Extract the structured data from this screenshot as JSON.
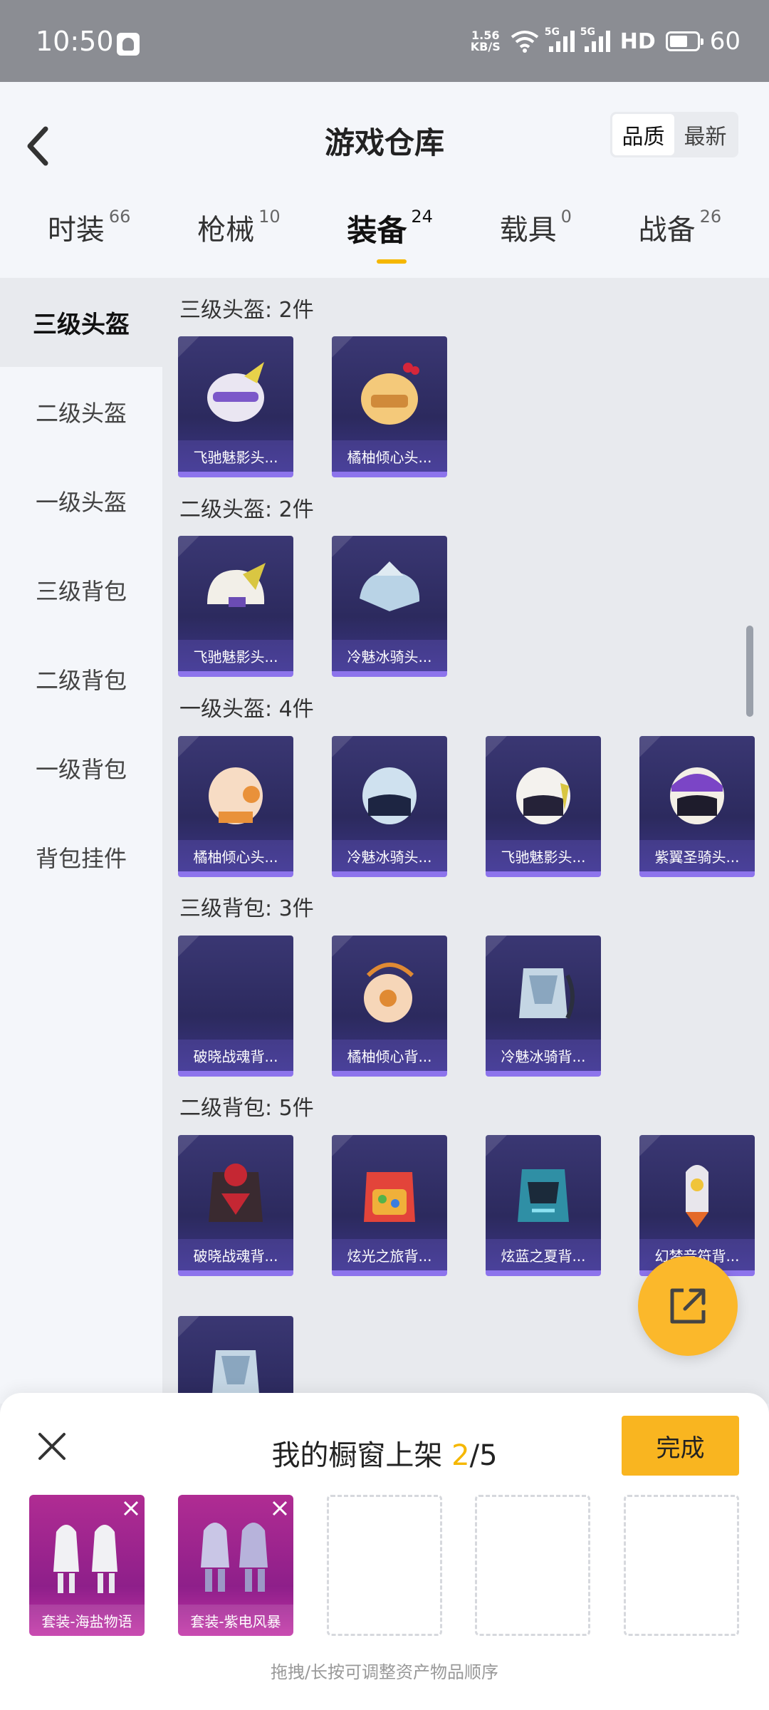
{
  "status": {
    "time": "10:50",
    "net_speed_top": "1.56",
    "net_speed_bottom": "KB/S",
    "battery": "60",
    "sim1": "5G",
    "sim2": "5G",
    "hd": "HD"
  },
  "header": {
    "title": "游戏仓库",
    "sort_quality": "品质",
    "sort_latest": "最新"
  },
  "tabs": [
    {
      "label": "时装",
      "count": "66"
    },
    {
      "label": "枪械",
      "count": "10"
    },
    {
      "label": "装备",
      "count": "24"
    },
    {
      "label": "载具",
      "count": "0"
    },
    {
      "label": "战备",
      "count": "26"
    }
  ],
  "sidebar": {
    "items": [
      "三级头盔",
      "二级头盔",
      "一级头盔",
      "三级背包",
      "二级背包",
      "一级背包",
      "背包挂件"
    ]
  },
  "sections": [
    {
      "title": "三级头盔: 2件",
      "items": [
        "飞驰魅影头...",
        "橘柚倾心头..."
      ]
    },
    {
      "title": "二级头盔: 2件",
      "items": [
        "飞驰魅影头...",
        "冷魅冰骑头..."
      ]
    },
    {
      "title": "一级头盔: 4件",
      "items": [
        "橘柚倾心头...",
        "冷魅冰骑头...",
        "飞驰魅影头...",
        "紫翼圣骑头..."
      ]
    },
    {
      "title": "三级背包: 3件",
      "items": [
        "破晓战魂背...",
        "橘柚倾心背...",
        "冷魅冰骑背..."
      ]
    },
    {
      "title": "二级背包: 5件",
      "items": [
        "破晓战魂背...",
        "炫光之旅背...",
        "炫蓝之夏背...",
        "幻梦音符背..."
      ]
    }
  ],
  "panel": {
    "title_prefix": "我的橱窗上架 ",
    "count_current": "2",
    "count_total": "/5",
    "done": "完成",
    "slots": [
      "套装-海盐物语",
      "套装-紫电风暴"
    ],
    "hint": "拖拽/长按可调整资产物品顺序"
  },
  "colors": {
    "accent": "#f5b700",
    "done_button": "#f9b520",
    "card_bg": "#2c2a5e",
    "card_border": "#8d74ec",
    "slot_bg": "#9e2590"
  }
}
